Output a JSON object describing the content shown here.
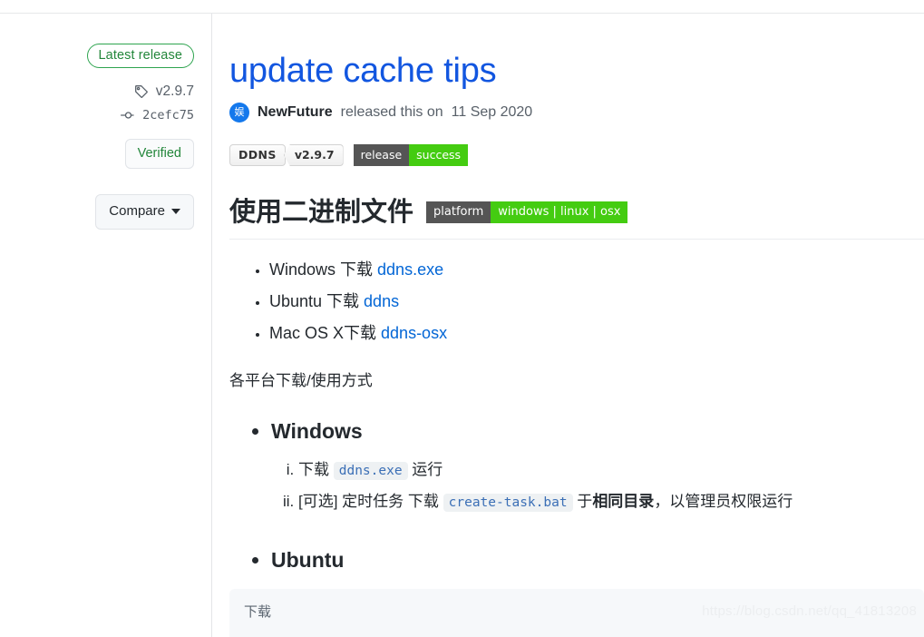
{
  "sidebar": {
    "latest_release_label": "Latest release",
    "tag_icon": "tag-icon",
    "tag_label": "v2.9.7",
    "commit_icon": "git-commit-icon",
    "commit_label": "2cefc75",
    "verified_label": "Verified",
    "compare_label": "Compare",
    "caret_icon": "chevron-down-icon"
  },
  "release": {
    "title": "update cache tips",
    "avatar_initial": "娱",
    "author": "NewFuture",
    "byline_suffix": " released this on 11 Sep 2020",
    "byline_released": "released this on",
    "byline_date": "11 Sep 2020"
  },
  "badges": [
    {
      "name": "ddns-badge",
      "label": "DDNS",
      "value": "v2.9.7"
    },
    {
      "name": "release-badge",
      "label": "release",
      "value": "success"
    }
  ],
  "body": {
    "h2_text": "使用二进制文件",
    "platform_badge": {
      "label": "platform",
      "value": "windows | linux | osx"
    },
    "download_list": [
      {
        "prefix": "Windows 下载 ",
        "link": "ddns.exe"
      },
      {
        "prefix": "Ubuntu 下载 ",
        "link": "ddns"
      },
      {
        "prefix": "Mac OS X下载 ",
        "link": "ddns-osx"
      }
    ],
    "paragraph": "各平台下载/使用方式",
    "sections": [
      {
        "heading": "Windows",
        "steps": [
          {
            "pre": "下载 ",
            "code": "ddns.exe",
            "post": " 运行",
            "strong": "",
            "tail": ""
          },
          {
            "pre": "[可选] 定时任务 下载 ",
            "code": "create-task.bat",
            "post": " 于",
            "strong": "相同目录",
            "tail": "，以管理员权限运行"
          }
        ]
      },
      {
        "heading": "Ubuntu",
        "steps": []
      }
    ],
    "code_block": "下载"
  },
  "watermark": "https://blog.csdn.net/qq_41813208",
  "colors": {
    "title_link": "#1256e0",
    "link": "#0366d6",
    "green": "#22863a",
    "badge_green": "#44cc11",
    "badge_gray": "#555555",
    "border": "#e1e4e8"
  }
}
